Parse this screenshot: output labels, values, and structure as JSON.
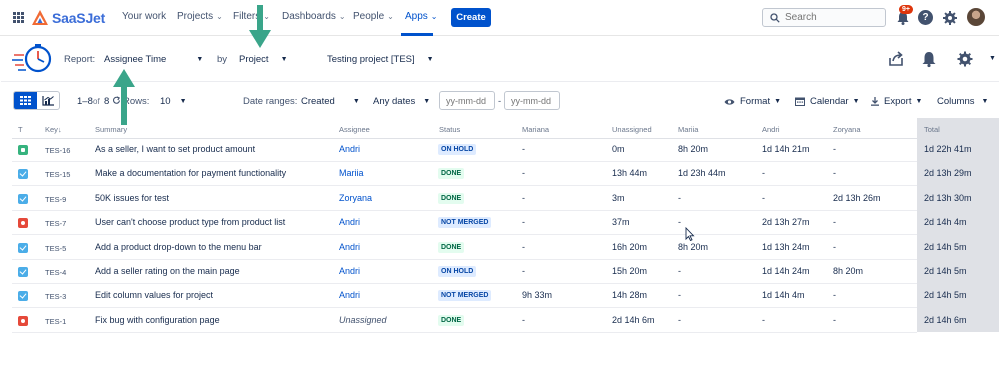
{
  "brand": {
    "name": "SaaSJet"
  },
  "nav": {
    "items": [
      {
        "label": "Your work",
        "chevron": false
      },
      {
        "label": "Projects",
        "chevron": true
      },
      {
        "label": "Filters",
        "chevron": true
      },
      {
        "label": "Dashboards",
        "chevron": true
      },
      {
        "label": "People",
        "chevron": true
      },
      {
        "label": "Apps",
        "chevron": true,
        "active": true
      }
    ],
    "create_label": "Create",
    "search_placeholder": "Search",
    "notifications_badge": "9+",
    "help_label": "?"
  },
  "report": {
    "report_label": "Report:",
    "report_value": "Assignee Time",
    "by_label": "by",
    "by_value": "Project",
    "project_value": "Testing project [TES]"
  },
  "toolbar": {
    "range_text": "1–8",
    "of_text": "of",
    "total_count": "8",
    "rows_label": "Rows:",
    "rows_value": "10",
    "date_ranges_label": "Date ranges:",
    "date_field": "Created",
    "date_period": "Any dates",
    "date_from_placeholder": "yy-mm-dd",
    "date_sep": "-",
    "date_to_placeholder": "yy-mm-dd",
    "format_label": "Format",
    "calendar_label": "Calendar",
    "export_label": "Export",
    "columns_label": "Columns"
  },
  "table": {
    "headers": [
      "T",
      "Key",
      "Summary",
      "Assignee",
      "Status",
      "Mariana",
      "Unassigned",
      "Mariia",
      "Andri",
      "Zoryana",
      "Total"
    ],
    "sort_indicator": "↓",
    "rows": [
      {
        "type": "story",
        "key": "TES-16",
        "summary": "As a seller, I want to set product amount",
        "assignee": "Andri",
        "status": "ON HOLD",
        "status_color": "blue",
        "mariana": "-",
        "unassigned": "0m",
        "mariia": "8h 20m",
        "andri": "1d 14h 21m",
        "zoryana": "-",
        "total": "1d 22h 41m"
      },
      {
        "type": "task",
        "key": "TES-15",
        "summary": "Make a documentation for payment functionality",
        "assignee": "Mariia",
        "status": "DONE",
        "status_color": "green",
        "mariana": "-",
        "unassigned": "13h 44m",
        "mariia": "1d 23h 44m",
        "andri": "-",
        "zoryana": "-",
        "total": "2d 13h 29m"
      },
      {
        "type": "task",
        "key": "TES-9",
        "summary": "50K issues for test",
        "assignee": "Zoryana",
        "status": "DONE",
        "status_color": "green",
        "mariana": "-",
        "unassigned": "3m",
        "mariia": "-",
        "andri": "-",
        "zoryana": "2d 13h 26m",
        "total": "2d 13h 30m"
      },
      {
        "type": "bug",
        "key": "TES-7",
        "summary": "User can't choose product type from product list",
        "assignee": "Andri",
        "status": "NOT MERGED",
        "status_color": "blue",
        "mariana": "-",
        "unassigned": "37m",
        "mariia": "-",
        "andri": "2d 13h 27m",
        "zoryana": "-",
        "total": "2d 14h 4m"
      },
      {
        "type": "task",
        "key": "TES-5",
        "summary": "Add a product drop-down to the menu bar",
        "assignee": "Andri",
        "status": "DONE",
        "status_color": "green",
        "mariana": "-",
        "unassigned": "16h 20m",
        "mariia": "8h 20m",
        "andri": "1d 13h 24m",
        "zoryana": "-",
        "total": "2d 14h 5m"
      },
      {
        "type": "task",
        "key": "TES-4",
        "summary": "Add a seller rating on the main page",
        "assignee": "Andri",
        "status": "ON HOLD",
        "status_color": "blue",
        "mariana": "-",
        "unassigned": "15h 20m",
        "mariia": "-",
        "andri": "1d 14h 24m",
        "zoryana": "8h 20m",
        "total": "2d 14h 5m"
      },
      {
        "type": "task",
        "key": "TES-3",
        "summary": "Edit column values for project",
        "assignee": "Andri",
        "status": "NOT MERGED",
        "status_color": "blue",
        "mariana": "9h 33m",
        "unassigned": "14h 28m",
        "mariia": "-",
        "andri": "1d 14h 4m",
        "zoryana": "-",
        "total": "2d 14h 5m"
      },
      {
        "type": "bug",
        "key": "TES-1",
        "summary": "Fix bug with configuration page",
        "assignee": "Unassigned",
        "assignee_unassigned": true,
        "status": "DONE",
        "status_color": "green",
        "mariana": "-",
        "unassigned": "2d 14h 6m",
        "mariia": "-",
        "andri": "-",
        "zoryana": "-",
        "total": "2d 14h 6m"
      }
    ]
  },
  "colors": {
    "brand_blue": "#0052cc",
    "annotation_arrow": "#3aa58a",
    "status_blue_bg": "#deebff",
    "status_green_bg": "#e3fcef",
    "total_column_bg": "#dfe1e6"
  },
  "icons": [
    "app-grid-icon",
    "saasjet-logo-icon",
    "search-icon",
    "bell-icon",
    "help-icon",
    "gear-icon",
    "report-clock-logo",
    "share-icon",
    "grid-view-icon",
    "chart-view-icon",
    "refresh-icon",
    "eye-icon",
    "calendar-icon",
    "download-icon"
  ]
}
